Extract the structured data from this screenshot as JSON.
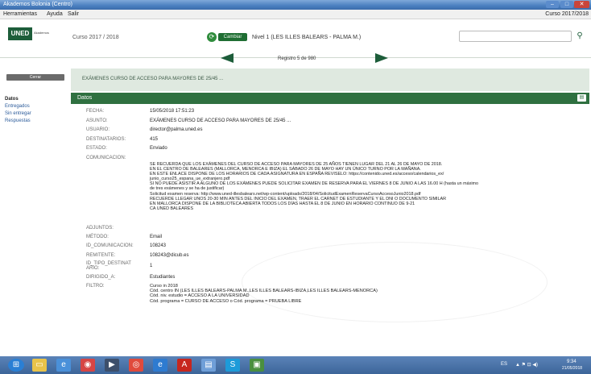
{
  "window": {
    "title": "Akademos Bolonia (Centro)",
    "min": "–",
    "max": "□",
    "close": "✕"
  },
  "menu": {
    "items": [
      "Herramientas",
      "Ayuda",
      "Salir"
    ],
    "course_right": "Curso 2017/2018"
  },
  "header": {
    "logo_text": "UNED",
    "logo_sub": "Akademos",
    "course": "Curso 2017 / 2018",
    "change_label": "Cambiar",
    "level": "Nivel 1 (LES ILLES  BALEARS - PALMA M.)",
    "search_placeholder": "",
    "search_icon": "search-icon"
  },
  "nav": {
    "record_text": "Registro 5 de 980"
  },
  "close_label": "Cerrar",
  "banner": "EXÁMENES CURSO DE ACCESO PARA MAYORES DE 25/45 ...",
  "sidebar": [
    {
      "label": "Datos",
      "active": true
    },
    {
      "label": "Entregados",
      "active": false
    },
    {
      "label": "Sin entregar",
      "active": false
    },
    {
      "label": "Respuestas",
      "active": false
    }
  ],
  "panel": {
    "title": "Datos",
    "print_icon": "print-icon"
  },
  "fields": {
    "fecha": {
      "label": "FECHA:",
      "value": "15/05/2018 17:51:23"
    },
    "asunto": {
      "label": "ASUNTO:",
      "value": "EXÁMENES CURSO DE ACCESO PARA MAYORES DE 25/45 ..."
    },
    "usuario": {
      "label": "USUARIO:",
      "value": "director@palma.uned.es"
    },
    "destinatarios": {
      "label": "DESTINATARIOS:",
      "value": "415"
    },
    "estado": {
      "label": "ESTADO:",
      "value": "Enviado"
    },
    "comunicacion_label": "COMUNICACION:",
    "comunicacion_lines": [
      "SE RECUERDA QUE LOS EXÁMENES DEL CURSO DE ACCESO PARA MAYORES DE 25 AÑOS TIENEN LUGAR DEL 21 AL 26 DE MAYO DE 2018.",
      "EN EL CENTRO DE BALEARES (MALLORCA, MENORCA E IBIZA) EL SÁBADO 26 DE MAYO HAY UN ÚNICO TURNO POR LA MAÑANA.",
      "EN ESTE ENLACE DISPONE DE LOS HORARIOS DE CADA ASIGNATURA EN ESPAÑA REVISELO: https://contenido.uned.es/acceso/calendarios_ex/",
      "junio_curso25_espana_ue_extranjero.pdf",
      "SI NO PUEDE ASISTIR A ALGUNO DE LOS EXÁMENES PUEDE SOLICITAR EXAMEN DE RESERVA PARA EL VIERNES 8 DE JUNIO A LAS 16.00 H (hasta un máximo",
      "de tres exámenes y se ha de justificar)",
      "Solicitud examen reserva: http://www.uned-illesbalears.net/wp-content/uploads/2018/04/SolicitudExamenReservaCursoAccesoJunio2018.pdf",
      "RECUERDE LLEGAR UNOS 20-30 MIN ANTES DEL INICIO DEL EXAMEN, TRAER EL CARNET DE ESTUDIANTE Y EL DNI O DOCUMENTO SIMILAR",
      "EN MALLORCA DISPONE DE LA BIBLIOTECA ABIERTA TODOS LOS DÍAS HASTA EL 8 DE JUNIO EN HORARIO CONTINUO DE 9-21",
      "CA UNED BALEARES"
    ],
    "adjuntos": {
      "label": "ADJUNTOS:",
      "value": ""
    },
    "metodo": {
      "label": "MÉTODO:",
      "value": "Email"
    },
    "id_comunicacion": {
      "label": "ID_COMUNICACION:",
      "value": "108243"
    },
    "remitente": {
      "label": "REMITENTE:",
      "value": "108243@dicub.es"
    },
    "id_tipo_destinat_1": "ID_TIPO_DESTINAT",
    "id_tipo_destinat_2": "ARIO:",
    "id_tipo_destinat_value": "1",
    "dirigido": {
      "label": "DIRIGIDO_A:",
      "value": "Estudiantes"
    },
    "filtro_label": "FILTRO:",
    "filtro_lines": [
      "Curso in 2018",
      "Cód. centro IN (LES ILLES  BALEARS-PALMA M.,LES ILLES BALEARS-IBIZA,LES ILLES BALEARS-MENORCA)",
      "Cód. niv. estudio = ACCESO A LA UNIVERSIDAD",
      "Cód. programa = CURSO DE ACCESO o Cód. programa = PRUEBA LIBRE"
    ]
  },
  "taskbar": {
    "tray_lang": "ES",
    "time": "9:34",
    "date": "21/05/2018"
  },
  "colors": {
    "brand_green": "#2f7040",
    "banner_bg": "#dfe9e0",
    "taskbar": "#3c6599"
  }
}
